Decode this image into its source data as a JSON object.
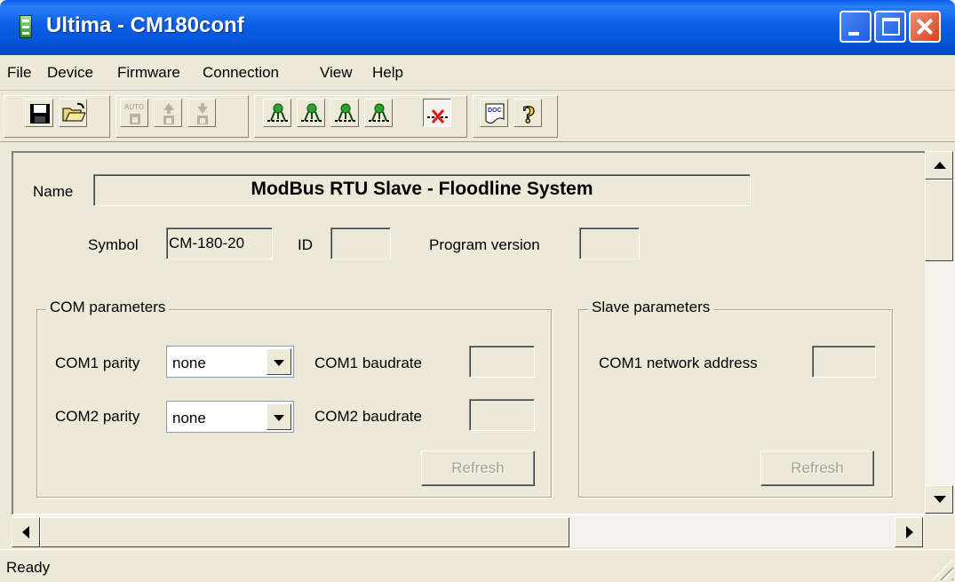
{
  "window": {
    "title": "Ultima - CM180conf"
  },
  "menu": [
    "File",
    "Device",
    "Firmware",
    "Connection",
    "View",
    "Help"
  ],
  "toolbar": {
    "icons": [
      "save-icon",
      "open-folder-icon",
      "auto-upload-icon",
      "upload-icon",
      "download-icon",
      "connect1-icon",
      "connect2-icon",
      "connect3-icon",
      "connect4-icon",
      "disconnect-icon",
      "doc-icon",
      "help-icon"
    ],
    "auto_text": "AUTO",
    "doc_text": "DOC"
  },
  "form": {
    "name_label": "Name",
    "name_value": "ModBus RTU Slave - Floodline System",
    "symbol_label": "Symbol",
    "symbol_value": "CM-180-20",
    "id_label": "ID",
    "id_value": "",
    "program_version_label": "Program version",
    "program_version_value": ""
  },
  "com_group": {
    "title": "COM parameters",
    "com1_parity_label": "COM1 parity",
    "com1_parity_value": "none",
    "com2_parity_label": "COM2 parity",
    "com2_parity_value": "none",
    "com1_baud_label": "COM1 baudrate",
    "com1_baud_value": "",
    "com2_baud_label": "COM2 baudrate",
    "com2_baud_value": "",
    "refresh_label": "Refresh"
  },
  "slave_group": {
    "title": "Slave parameters",
    "addr_label": "COM1 network address",
    "addr_value": "",
    "refresh_label": "Refresh"
  },
  "status": {
    "text": "Ready"
  },
  "colors": {
    "titlebar": "#0554e0",
    "face": "#ece9d8",
    "close": "#d2451c"
  }
}
